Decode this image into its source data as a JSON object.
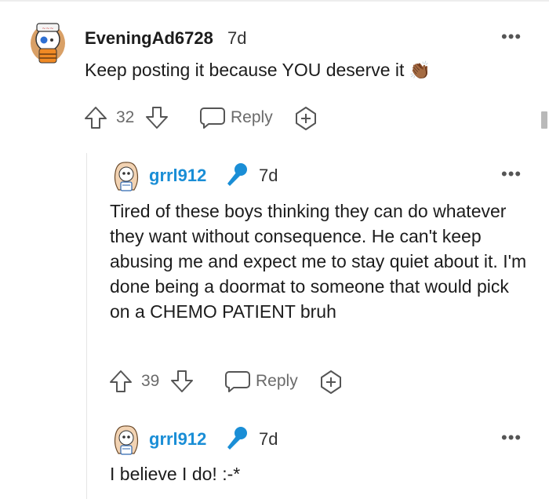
{
  "comments": [
    {
      "username": "EveningAd6728",
      "age": "7d",
      "body": "Keep posting it because YOU deserve it",
      "emoji": "👏🏾",
      "votes": "32",
      "reply_label": "Reply"
    },
    {
      "username": "grrl912",
      "flair_icon": "microphone-icon",
      "age": "7d",
      "body": "Tired of these boys thinking they can do whatever they want without consequence. He can't keep abusing me and expect me to stay quiet about it. I'm done being a doormat to someone that would pick on a CHEMO PATIENT bruh",
      "votes": "39",
      "reply_label": "Reply"
    },
    {
      "username": "grrl912",
      "flair_icon": "microphone-icon",
      "age": "7d",
      "body": "I believe I do! :-*"
    }
  ],
  "colors": {
    "op_username": "#1c1c1c",
    "reply_username": "#1a8ed6",
    "mic": "#1a8ed6",
    "meta": "#6a6a6a"
  }
}
